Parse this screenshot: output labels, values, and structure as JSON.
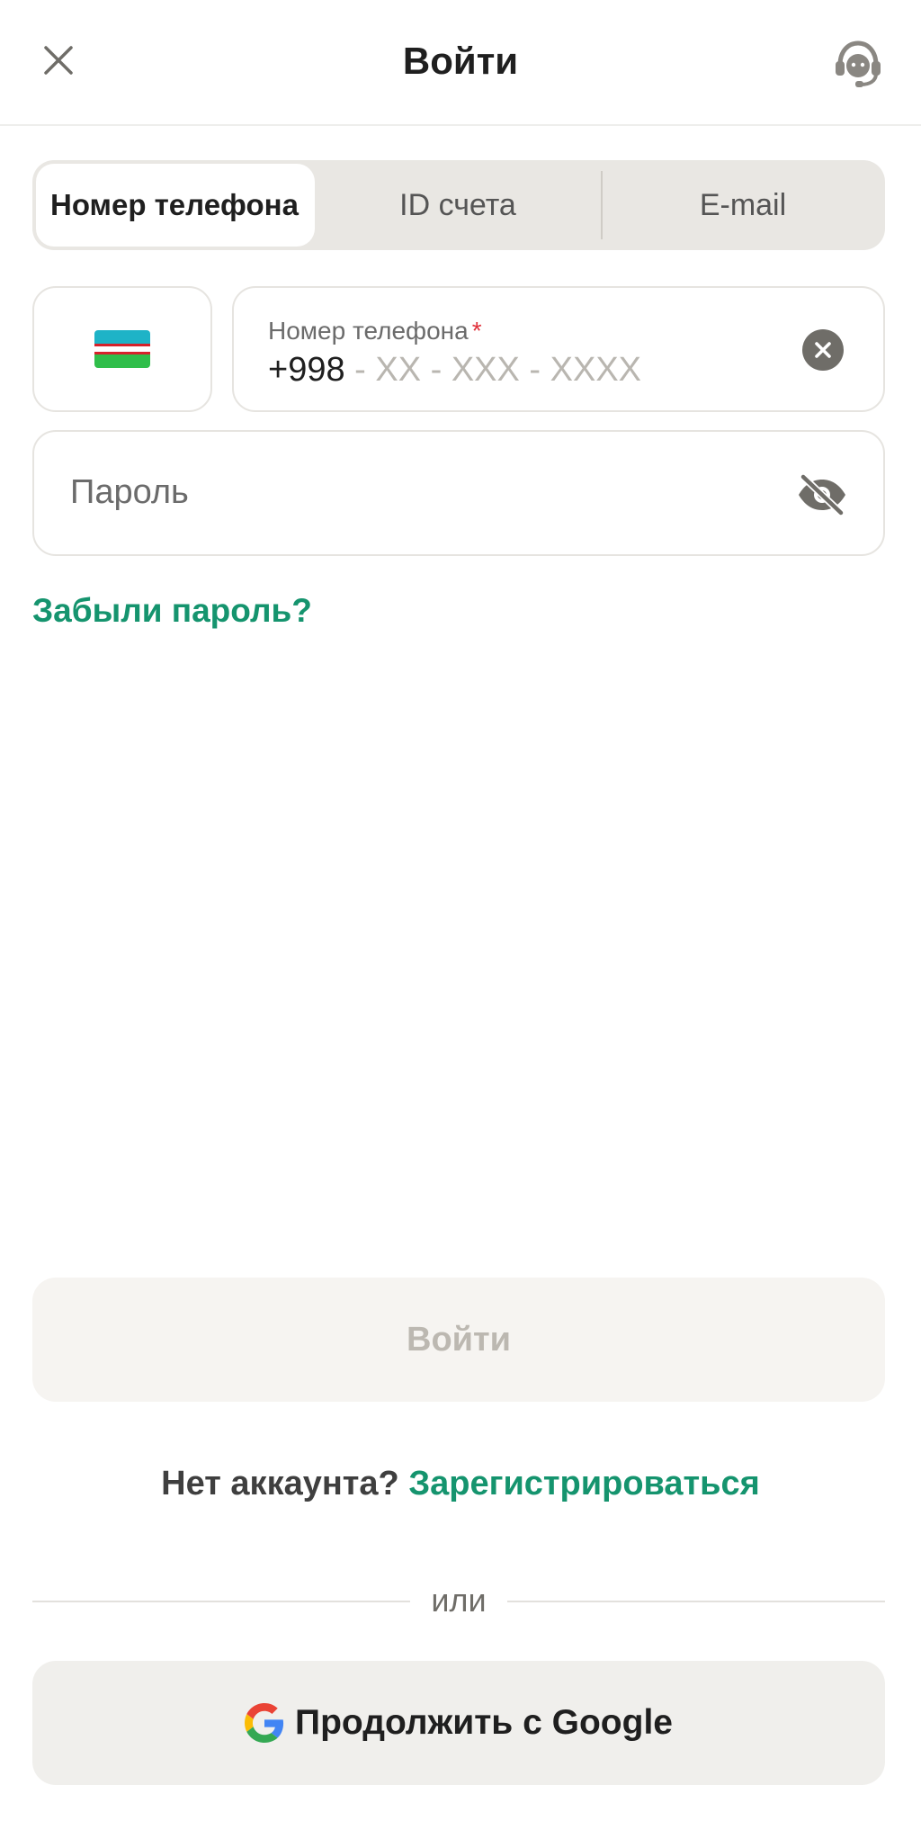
{
  "header": {
    "title": "Войти"
  },
  "tabs": [
    {
      "label": "Номер телефона",
      "active": true
    },
    {
      "label": "ID счета",
      "active": false
    },
    {
      "label": "E-mail",
      "active": false
    }
  ],
  "phone_field": {
    "label": "Номер телефона",
    "required_mark": "*",
    "country_code": "+998",
    "mask": " - XX - XXX - XXXX"
  },
  "password_field": {
    "placeholder": "Пароль"
  },
  "forgot_password_link": "Забыли пароль?",
  "login_button": "Войти",
  "signup": {
    "question": "Нет аккаунта?",
    "link": "Зарегистрироваться"
  },
  "divider_text": "или",
  "google_button": "Продолжить с Google",
  "colors": {
    "accent": "#15946e",
    "required": "#e0313b",
    "button_disabled_text": "#bcb8b1"
  }
}
